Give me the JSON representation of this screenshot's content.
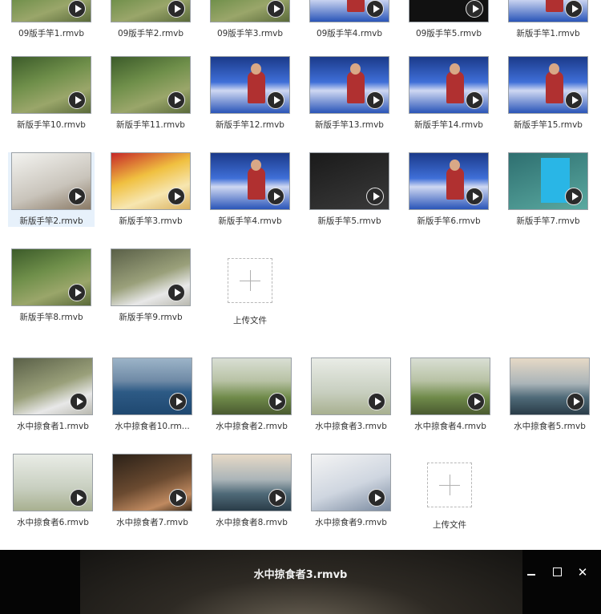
{
  "group1": [
    {
      "name": "09版手竿1.rmvb",
      "theme": "t-green"
    },
    {
      "name": "09版手竿2.rmvb",
      "theme": "t-green"
    },
    {
      "name": "09版手竿3.rmvb",
      "theme": "t-green"
    },
    {
      "name": "09版手竿4.rmvb",
      "theme": "t-studio"
    },
    {
      "name": "09版手竿5.rmvb",
      "theme": "t-black"
    },
    {
      "name": "新版手竿1.rmvb",
      "theme": "t-studio"
    },
    {
      "name": "新版手竿10.rmvb",
      "theme": "t-green"
    },
    {
      "name": "新版手竿11.rmvb",
      "theme": "t-green"
    },
    {
      "name": "新版手竿12.rmvb",
      "theme": "t-studio"
    },
    {
      "name": "新版手竿13.rmvb",
      "theme": "t-studio"
    },
    {
      "name": "新版手竿14.rmvb",
      "theme": "t-studio"
    },
    {
      "name": "新版手竿15.rmvb",
      "theme": "t-studio"
    },
    {
      "name": "新版手竿2.rmvb",
      "theme": "t-hand",
      "selected": true
    },
    {
      "name": "新版手竿3.rmvb",
      "theme": "t-red"
    },
    {
      "name": "新版手竿4.rmvb",
      "theme": "t-studio"
    },
    {
      "name": "新版手竿5.rmvb",
      "theme": "t-dark"
    },
    {
      "name": "新版手竿6.rmvb",
      "theme": "t-studio"
    },
    {
      "name": "新版手竿7.rmvb",
      "theme": "t-teal"
    },
    {
      "name": "新版手竿8.rmvb",
      "theme": "t-green"
    },
    {
      "name": "新版手竿9.rmvb",
      "theme": "t-person"
    }
  ],
  "group2": [
    {
      "name": "水中掠食者1.rmvb",
      "theme": "t-person"
    },
    {
      "name": "水中掠食者10.rm...",
      "theme": "t-lake"
    },
    {
      "name": "水中掠食者2.rmvb",
      "theme": "t-field"
    },
    {
      "name": "水中掠食者3.rmvb",
      "theme": "t-pale"
    },
    {
      "name": "水中掠食者4.rmvb",
      "theme": "t-field"
    },
    {
      "name": "水中掠食者5.rmvb",
      "theme": "t-boat"
    },
    {
      "name": "水中掠食者6.rmvb",
      "theme": "t-pale"
    },
    {
      "name": "水中掠食者7.rmvb",
      "theme": "t-closeup"
    },
    {
      "name": "水中掠食者8.rmvb",
      "theme": "t-boat"
    },
    {
      "name": "水中掠食者9.rmvb",
      "theme": "t-cap"
    }
  ],
  "upload_label": "上传文件",
  "viewer": {
    "title": "水中掠食者3.rmvb",
    "close_glyph": "✕"
  }
}
